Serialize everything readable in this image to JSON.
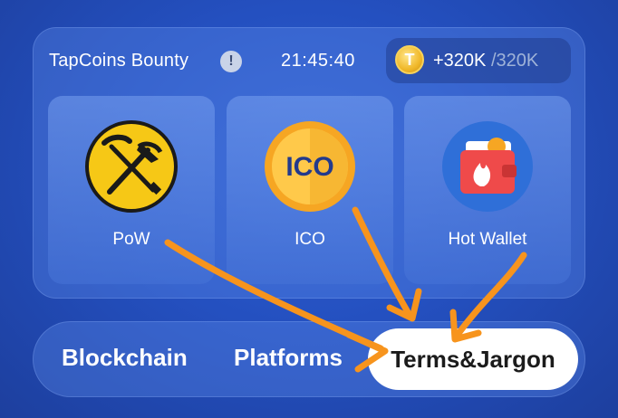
{
  "header": {
    "title": "TapCoins Bounty",
    "info_icon": "!",
    "timer": "21:45:40",
    "reward_current": "+320K",
    "reward_separator": " /",
    "reward_max": "320K",
    "coin_symbol": "T"
  },
  "cards": [
    {
      "label": "PoW",
      "icon": "pickaxe-shovel-icon"
    },
    {
      "label": "ICO",
      "icon": "ico-coin-icon",
      "icon_text": "ICO"
    },
    {
      "label": "Hot Wallet",
      "icon": "hot-wallet-icon"
    }
  ],
  "tabs": {
    "items": [
      "Blockchain",
      "Platforms",
      "Terms&Jargon"
    ],
    "active": "Terms&Jargon"
  },
  "colors": {
    "background": "#2450c0",
    "arrow": "#f7941d",
    "coin": "#f0b829",
    "active_tab": "#ffffff"
  }
}
